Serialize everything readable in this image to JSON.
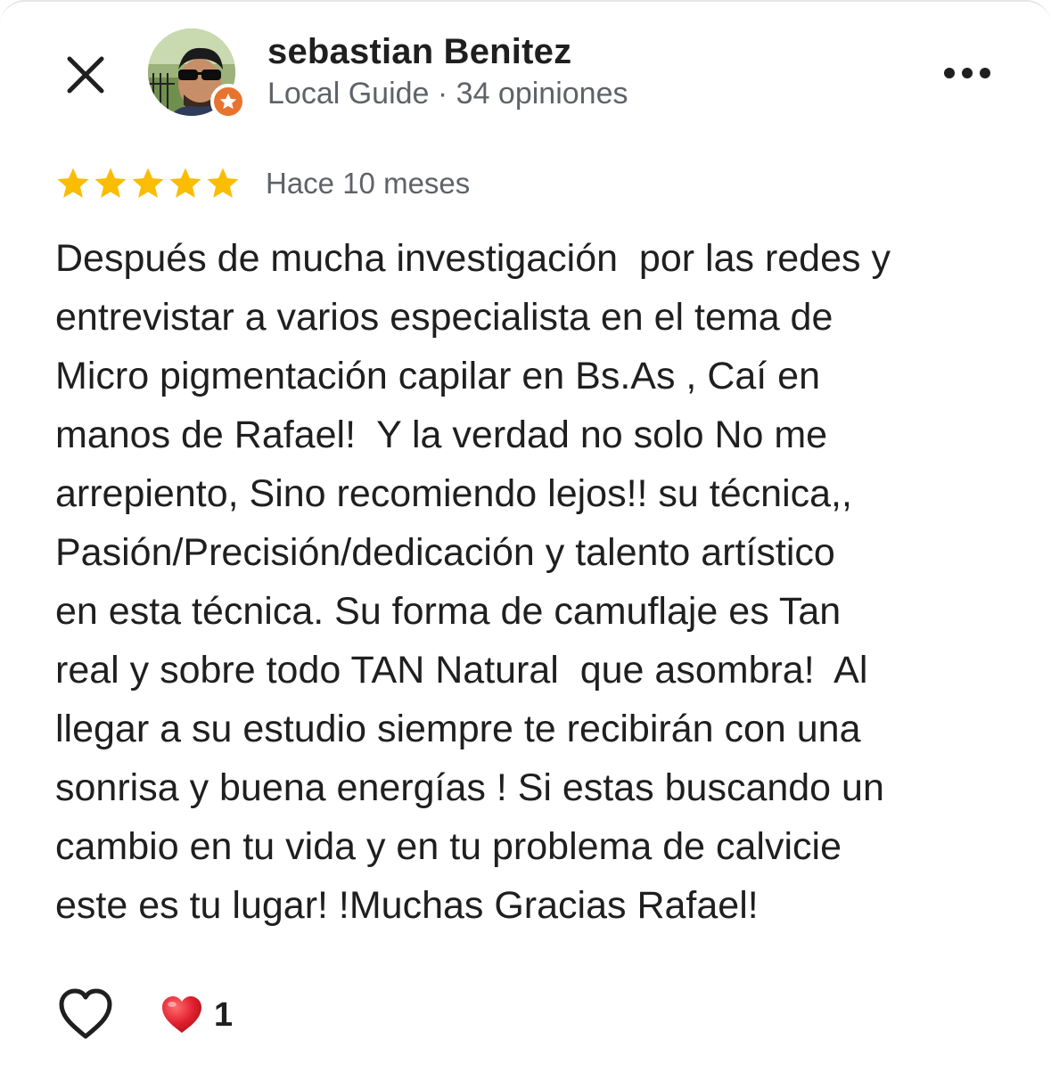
{
  "header": {
    "author_name": "sebastian Benitez",
    "author_meta": "Local Guide · 34 opiniones"
  },
  "icons": {
    "close": "close-icon",
    "more": "more-options-icon",
    "badge": "local-guide-star-icon",
    "like": "heart-outline-icon",
    "reaction": "red-heart-icon"
  },
  "review": {
    "rating": 5,
    "rating_max": 5,
    "time": "Hace 10 meses",
    "lines": [
      "Después de mucha investigación  por las redes y",
      "entrevistar a varios especialista en el tema de",
      "Micro pigmentación capilar en Bs.As , Caí en",
      "manos de Rafael!  Y la verdad no solo No me",
      "arrepiento, Sino recomiendo lejos!! su técnica,,",
      "Pasión/Precisión/dedicación y talento artístico",
      "en esta técnica. Su forma de camuflaje es Tan",
      "real y sobre todo TAN Natural  que asombra!  Al",
      "llegar a su estudio siempre te recibirán con una",
      "sonrisa y buena energías ! Si estas buscando un",
      "cambio en tu vida y en tu problema de calvicie",
      "este es tu lugar! !Muchas Gracias Rafael!"
    ]
  },
  "reactions": {
    "count": "1"
  },
  "colors": {
    "star": "#FBBC04",
    "badge": "#E8732F",
    "heart": "#E0202E",
    "text": "#1F1F1F",
    "secondary_text": "#5F6368"
  }
}
